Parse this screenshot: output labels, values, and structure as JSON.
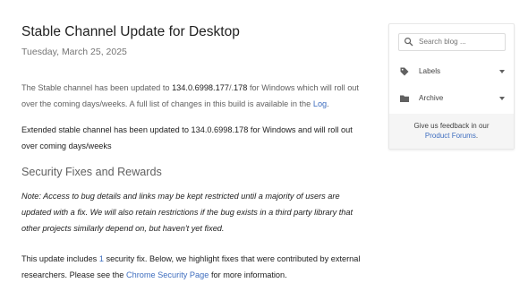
{
  "post": {
    "title": "Stable Channel Update for Desktop",
    "date": "Tuesday, March 25, 2025",
    "p1_a": "The Stable channel has been updated to ",
    "p1_version_a": "134.0.6998.177",
    "p1_sep": "/.",
    "p1_version_b": "178",
    "p1_b": " for Windows which will roll out over the coming days/weeks. A full list of changes in this build is available in the ",
    "p1_link": "Log",
    "p1_end": ".",
    "p2": "Extended stable channel has been updated to 134.0.6998.178 for Windows and will roll out over coming days/weeks",
    "section_heading": "Security Fixes and Rewards",
    "note": "Note: Access to bug details and links may be kept restricted until a majority of users are updated with a fix. We will also retain restrictions if the bug exists in a third party library that other projects similarly depend on, but haven't yet fixed.",
    "p4_a": "This update includes ",
    "p4_count": "1",
    "p4_b": " security fix. Below, we highlight fixes that were contributed by external researchers. Please see the ",
    "p4_link": "Chrome Security Page",
    "p4_c": " for more information."
  },
  "sidebar": {
    "search_placeholder": "Search blog ...",
    "labels": "Labels",
    "archive": "Archive",
    "feedback_text": "Give us feedback in our",
    "feedback_link": "Product Forums",
    "feedback_end": "."
  },
  "icons": {
    "search": "search-icon",
    "labels": "label-tag-icon",
    "archive": "folder-icon",
    "dropdown": "chevron-down-icon"
  },
  "colors": {
    "link": "#3f6ebf",
    "text": "#212121",
    "muted": "#616161"
  }
}
